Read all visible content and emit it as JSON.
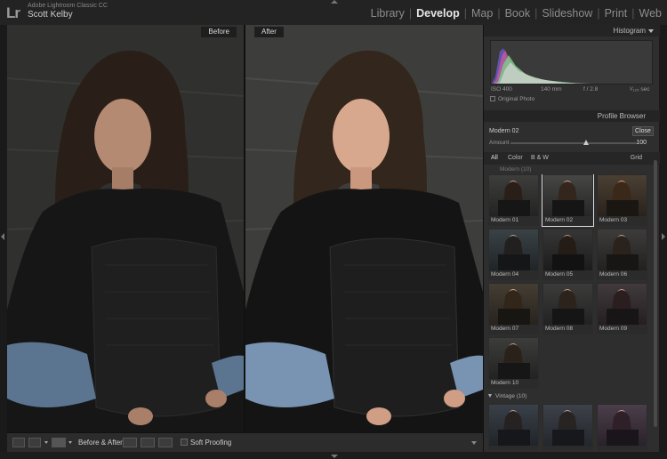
{
  "app": {
    "logo": "Lr",
    "product_name": "Adobe Lightroom Classic CC",
    "user_name": "Scott Kelby"
  },
  "modules": [
    {
      "label": "Library",
      "active": false
    },
    {
      "label": "Develop",
      "active": true
    },
    {
      "label": "Map",
      "active": false
    },
    {
      "label": "Book",
      "active": false
    },
    {
      "label": "Slideshow",
      "active": false
    },
    {
      "label": "Print",
      "active": false
    },
    {
      "label": "Web",
      "active": false
    }
  ],
  "center": {
    "before_label": "Before",
    "after_label": "After"
  },
  "toolbar": {
    "before_after_label": "Before & After :",
    "soft_proofing_label": "Soft Proofing"
  },
  "histogram": {
    "title": "Histogram",
    "iso": "ISO 400",
    "focal": "140 mm",
    "aperture": "f / 2.8",
    "shutter": "¹⁄₁₂₅ sec",
    "original_photo_label": "Original Photo"
  },
  "profile_browser": {
    "title": "Profile Browser",
    "current_profile": "Modern 02",
    "close_label": "Close",
    "amount_label": "Amount",
    "amount_value": "100",
    "amount_fraction": 0.6,
    "filters": [
      "All",
      "Color",
      "B & W"
    ],
    "grid_label": "Grid",
    "group_modern": "Modern (10)",
    "group_vintage": "Vintage (10)",
    "profiles": [
      "Modern 01",
      "Modern 02",
      "Modern 03",
      "Modern 04",
      "Modern 05",
      "Modern 06",
      "Modern 07",
      "Modern 08",
      "Modern 09",
      "Modern 10"
    ],
    "selected_index": 1
  },
  "colors": {
    "active_module": "#e6e6e6",
    "inactive_module": "#8c8c8c",
    "panel_bg": "#2e2e2e",
    "header_bg": "#242424"
  }
}
